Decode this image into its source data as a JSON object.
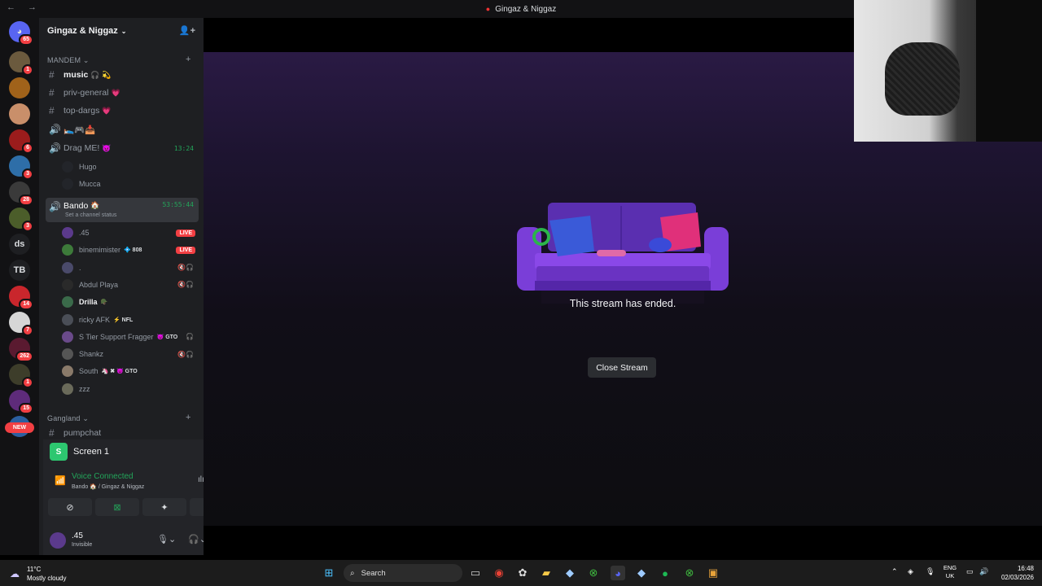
{
  "window": {
    "title": "Gingaz & Niggaz",
    "nav": "← →"
  },
  "servers": [
    {
      "label": "",
      "badge": "65",
      "color": "#5865f2",
      "icon": "discord-home-icon"
    },
    {
      "label": "",
      "badge": "1",
      "color": "#6b5a3e"
    },
    {
      "label": "",
      "badge": "",
      "color": "#a0621a"
    },
    {
      "label": "",
      "badge": "",
      "color": "#c98f6a"
    },
    {
      "label": "",
      "badge": "6",
      "color": "#9b1c1c"
    },
    {
      "label": "",
      "badge": "3",
      "color": "#2e6ea8"
    },
    {
      "label": "",
      "badge": "28",
      "color": "#3a3a3a"
    },
    {
      "label": "",
      "badge": "3",
      "color": "#4b5d2a"
    },
    {
      "label": "ds",
      "badge": "",
      "color": "#1e1f22"
    },
    {
      "label": "TB",
      "badge": "",
      "color": "#1e1f22"
    },
    {
      "label": "",
      "badge": "14",
      "color": "#c9262c"
    },
    {
      "label": "",
      "badge": "7",
      "color": "#d6d6d6"
    },
    {
      "label": "",
      "badge": "262",
      "color": "#5a1a30"
    },
    {
      "label": "",
      "badge": "1",
      "color": "#3d3d2a"
    },
    {
      "label": "",
      "badge": "15",
      "color": "#5e2b7a"
    },
    {
      "label": "",
      "badge": "",
      "color": "#2b5fa0"
    }
  ],
  "new_badge": "NEW",
  "guild": {
    "name": "Gingaz & Niggaz"
  },
  "categories": {
    "mandem": "MANDEM",
    "gangland": "Gangland"
  },
  "channels": [
    {
      "name": "music",
      "emoji": "🎧 💫",
      "type": "text"
    },
    {
      "name": "priv-general",
      "emoji": "💗",
      "type": "text"
    },
    {
      "name": "top-dargs",
      "emoji": "💗",
      "type": "text"
    },
    {
      "name": "🛌🎮📥",
      "emoji": "",
      "type": "voice"
    },
    {
      "name": "Drag ME!",
      "emoji": "😈",
      "type": "voice",
      "time": "13:24"
    }
  ],
  "drag_users": [
    "Hugo",
    "Mucca"
  ],
  "active_channel": {
    "name": "Bando",
    "emoji": "🏠",
    "time": "53:55:44",
    "status": "Set a channel status"
  },
  "bando_users": [
    {
      "name": ".45",
      "live": "LIVE",
      "tag": "",
      "color": "#5b3a8c"
    },
    {
      "name": "binemimister",
      "live": "LIVE",
      "tag": "💠 808",
      "color": "#3d7a3a"
    },
    {
      "name": ".",
      "live": "",
      "tag": "",
      "color": "#4a4a6a",
      "muted": "🔇🎧"
    },
    {
      "name": "Abdul Playa",
      "live": "",
      "tag": "",
      "color": "#2a2a2a",
      "muted": "🔇🎧"
    },
    {
      "name": "Drilla",
      "live": "",
      "tag": "🪖",
      "color": "#3a6a4a",
      "bright": true
    },
    {
      "name": "ricky AFK",
      "live": "",
      "tag": "⚡ NFL",
      "color": "#4a4e57"
    },
    {
      "name": "S Tier Support Fragger",
      "live": "",
      "tag": "😈 GTO",
      "color": "#6a4a8a",
      "muted": "🎧"
    },
    {
      "name": "Shankz",
      "live": "",
      "tag": "",
      "color": "#555",
      "muted": "🔇🎧"
    },
    {
      "name": "South",
      "live": "",
      "tag": "🦄 ✖ 😈 GTO",
      "color": "#8a7a6a"
    },
    {
      "name": "zzz",
      "live": "",
      "tag": "",
      "color": "#6a6a5a"
    }
  ],
  "gangland_channels": [
    {
      "name": "pumpchat"
    }
  ],
  "stream_panel": {
    "title": "Screen 1"
  },
  "voice": {
    "status": "Voice Connected",
    "location": "Bando 🏠 / Gingaz & Niggaz"
  },
  "me": {
    "name": ".45",
    "status": "Invisible"
  },
  "main": {
    "message": "This stream has ended.",
    "close_label": "Close Stream"
  },
  "taskbar": {
    "weather_temp": "11°C",
    "weather_desc": "Mostly cloudy",
    "search_placeholder": "Search",
    "lang": "ENG",
    "region": "UK",
    "time": "16:48",
    "date": "02/03/2026"
  }
}
